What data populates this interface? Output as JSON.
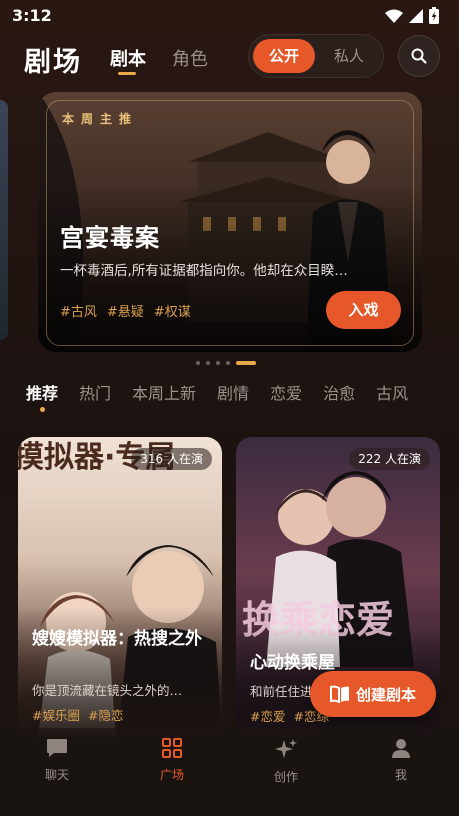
{
  "status_bar": {
    "time": "3:12"
  },
  "header": {
    "brand": "剧场",
    "tabs": [
      {
        "label": "剧本",
        "active": true
      },
      {
        "label": "角色",
        "active": false
      }
    ],
    "visibility": {
      "options": [
        "公开",
        "私人"
      ],
      "selected": "公开"
    },
    "search_icon": "search-icon"
  },
  "hero": {
    "tag": "本周主推",
    "title": "宫宴毒案",
    "description": "一杯毒酒后,所有证据都指向你。他却在众目睽…",
    "tags": [
      "#古风",
      "#悬疑",
      "#权谋"
    ],
    "button": "入戏",
    "carousel": {
      "count": 5,
      "active_index": 4
    }
  },
  "categories": {
    "items": [
      "推荐",
      "热门",
      "本周上新",
      "剧情",
      "恋爱",
      "治愈",
      "古风"
    ],
    "selected": "推荐"
  },
  "cards": [
    {
      "badge": "316 人在演",
      "cover_text": "摸拟器·专属",
      "title": "嫂嫂模拟器：热搜之外",
      "description": "你是顶流藏在镜头之外的…",
      "tags": [
        "#娱乐圈",
        "#隐恋"
      ]
    },
    {
      "badge": "222 人在演",
      "cover_text": "换乘恋爱",
      "title": "心动换乘屋",
      "description": "和前任住进",
      "tags": [
        "#恋爱",
        "#恋综"
      ]
    }
  ],
  "fab": {
    "label": "创建剧本",
    "icon": "book-icon"
  },
  "bottom_nav": [
    {
      "label": "聊天",
      "icon": "chat-icon",
      "active": false
    },
    {
      "label": "广场",
      "icon": "grid-icon",
      "active": true
    },
    {
      "label": "创作",
      "icon": "sparkle-icon",
      "active": false
    },
    {
      "label": "我",
      "icon": "user-icon",
      "active": false
    }
  ],
  "colors": {
    "accent": "#e6582a",
    "gold": "#e9a94a",
    "tag": "#d9a14e",
    "background": "#1d1310"
  }
}
